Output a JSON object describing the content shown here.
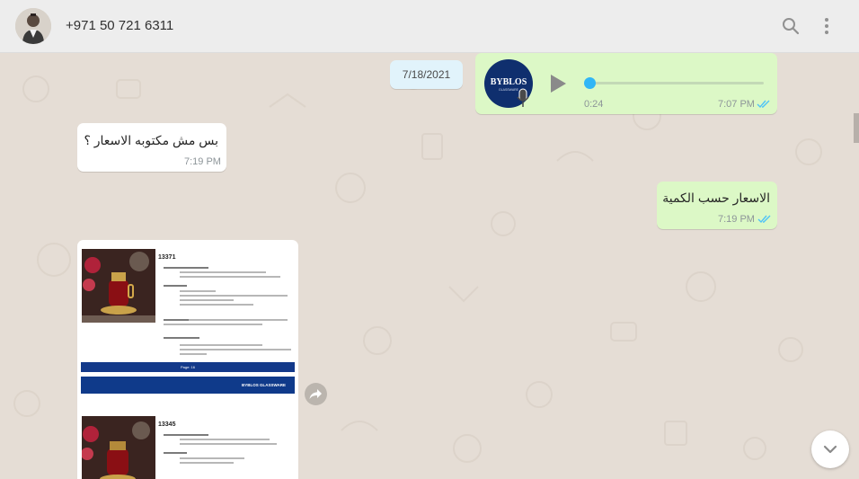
{
  "header": {
    "contact_name": "+971 50 721 6311",
    "search_icon": "search-icon",
    "menu_icon": "kebab-menu-icon"
  },
  "chat": {
    "date_chip": "7/18/2021",
    "voice_message": {
      "logo_text": "BYBLOS",
      "logo_subtext": "GLASSWARE",
      "duration": "0:24",
      "time": "7:07 PM",
      "progress": 0,
      "status": "read"
    },
    "incoming_1": {
      "text": "بس مش مكتوبه الاسعار ؟",
      "time": "7:19 PM"
    },
    "outgoing_1": {
      "text": "الاسعار حسب الكمية",
      "time": "7:19 PM",
      "status": "read"
    },
    "document": {
      "page1": {
        "code": "13371",
        "page_label": "Page: 16",
        "footer": "BYBLOS GLASSWARE"
      },
      "page2": {
        "code": "13345"
      }
    }
  },
  "colors": {
    "header_bg": "#ededed",
    "chat_bg": "#e5ddd5",
    "outgoing_bubble": "#dcf8c6",
    "incoming_bubble": "#ffffff",
    "date_chip_bg": "#e1f3fb",
    "read_ticks": "#4fc3f7",
    "brand_blue": "#13398a"
  }
}
